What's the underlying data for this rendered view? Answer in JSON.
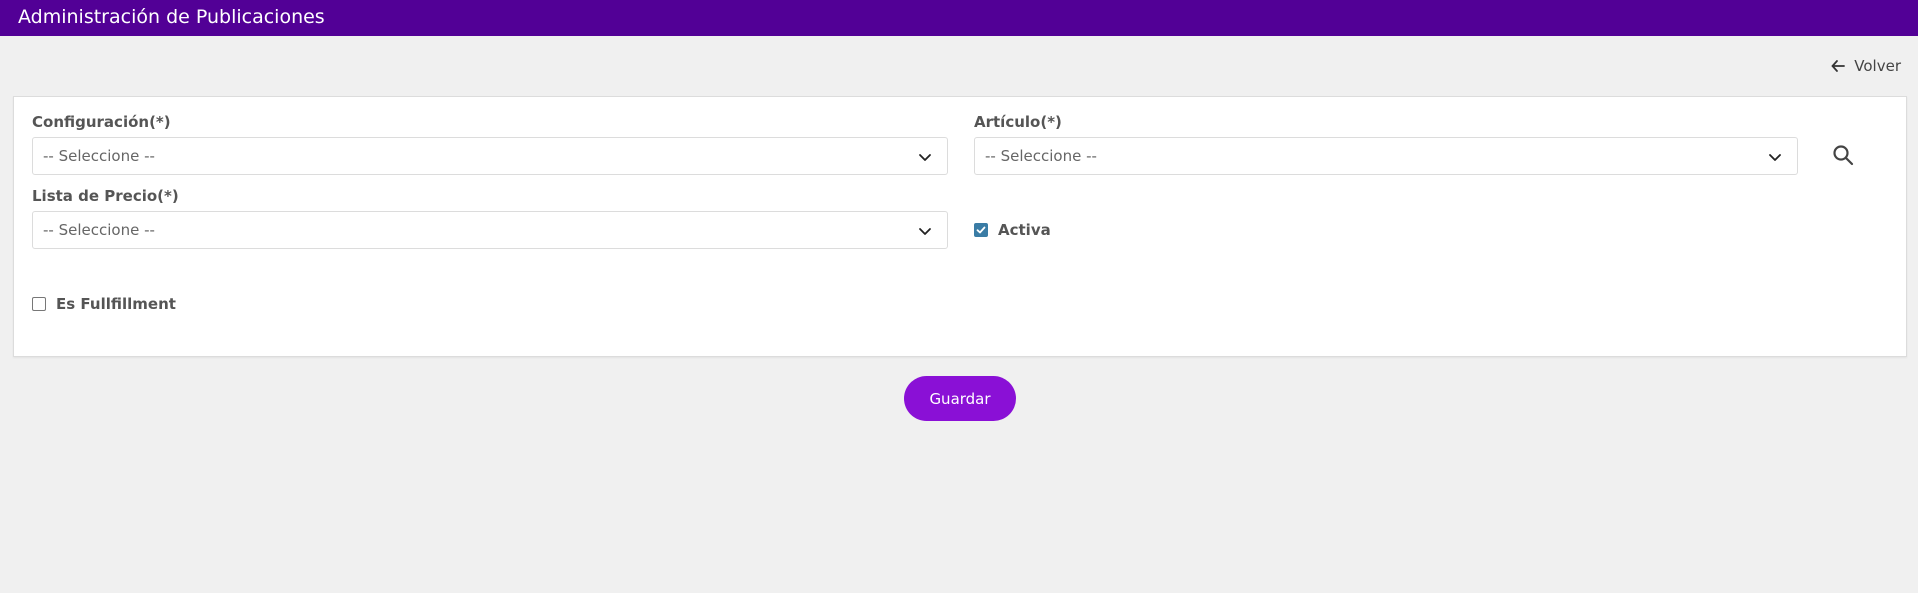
{
  "header": {
    "title": "Administración de Publicaciones"
  },
  "nav": {
    "back_label": "Volver"
  },
  "form": {
    "configuracion": {
      "label": "Configuración(*)",
      "value": "-- Seleccione --"
    },
    "articulo": {
      "label": "Artículo(*)",
      "value": "-- Seleccione --"
    },
    "lista_precio": {
      "label": "Lista de Precio(*)",
      "value": "-- Seleccione --"
    },
    "activa": {
      "label": "Activa",
      "checked": true
    },
    "fullfillment": {
      "label": "Es Fullfillment",
      "checked": false
    }
  },
  "actions": {
    "save_label": "Guardar"
  },
  "colors": {
    "header": "#520096",
    "primary_button": "#8a10d6",
    "checkbox": "#3a7ca5"
  }
}
